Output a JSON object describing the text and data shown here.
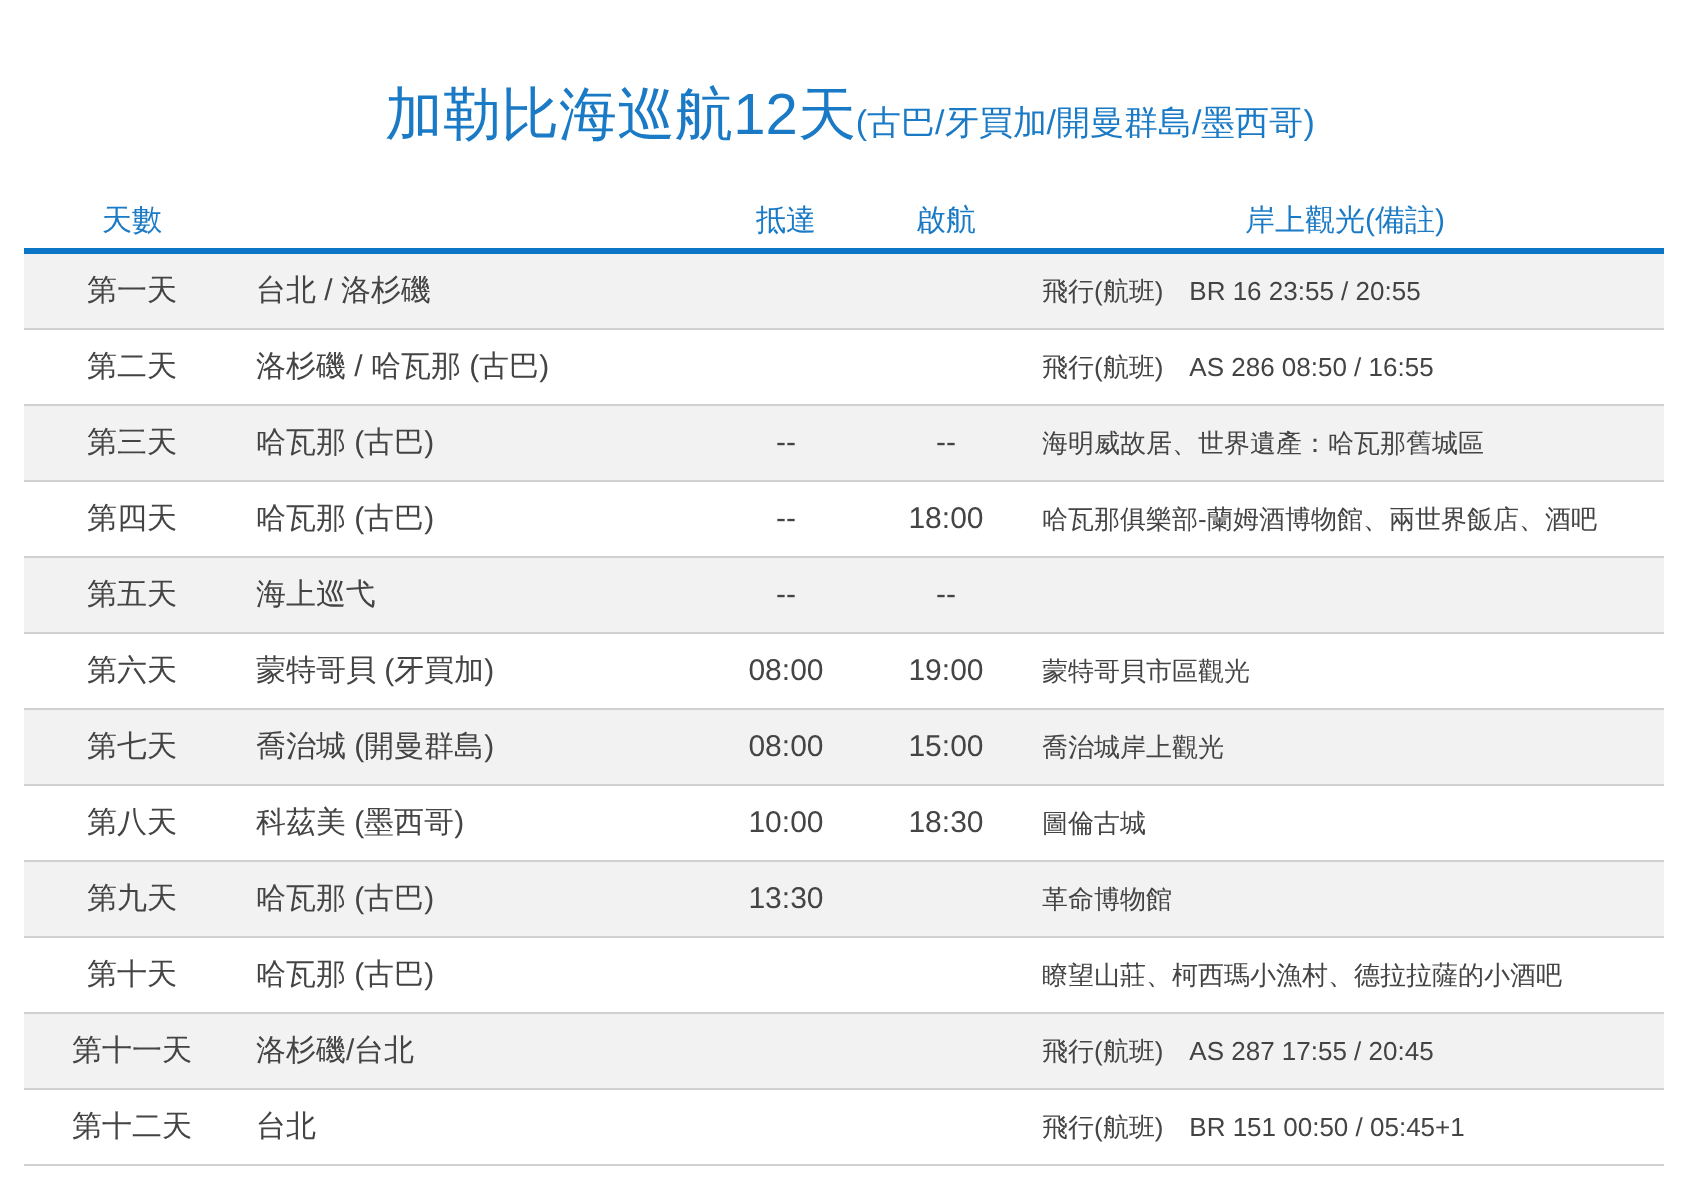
{
  "title": "加勒比海巡航12天",
  "subtitle": "(古巴/牙買加/開曼群島/墨西哥)",
  "header": {
    "day": "天數",
    "arrive": "抵達",
    "depart": "啟航",
    "notes": "岸上觀光(備註)"
  },
  "rows": [
    {
      "day": "第一天",
      "port": "台北 / 洛杉磯",
      "note": "飛行(航班)　BR 16 23:55 / 20:55"
    },
    {
      "day": "第二天",
      "port": "洛杉磯 / 哈瓦那 (古巴)",
      "note": "飛行(航班)　AS 286 08:50 / 16:55"
    },
    {
      "day": "第三天",
      "port": "哈瓦那 (古巴)",
      "arrive": "--",
      "depart": "--",
      "note": "海明威故居、世界遺產：哈瓦那舊城區"
    },
    {
      "day": "第四天",
      "port": "哈瓦那 (古巴)",
      "arrive": "--",
      "depart": "18:00",
      "note": "哈瓦那俱樂部-蘭姆酒博物館、兩世界飯店、酒吧"
    },
    {
      "day": "第五天",
      "port": "海上巡弋",
      "arrive": "--",
      "depart": "--"
    },
    {
      "day": "第六天",
      "port": "蒙特哥貝 (牙買加)",
      "arrive": "08:00",
      "depart": "19:00",
      "note": "蒙特哥貝市區觀光"
    },
    {
      "day": "第七天",
      "port": "喬治城 (開曼群島)",
      "arrive": "08:00",
      "depart": "15:00",
      "note": "喬治城岸上觀光"
    },
    {
      "day": "第八天",
      "port": "科茲美 (墨西哥)",
      "arrive": "10:00",
      "depart": "18:30",
      "note": "圖倫古城"
    },
    {
      "day": "第九天",
      "port": "哈瓦那 (古巴)",
      "arrive": "13:30",
      "note": "革命博物館"
    },
    {
      "day": "第十天",
      "port": "哈瓦那 (古巴)",
      "note": "瞭望山莊、柯西瑪小漁村、德拉拉薩的小酒吧"
    },
    {
      "day": "第十一天",
      "port": "洛杉磯/台北",
      "note": "飛行(航班)　AS 287 17:55 / 20:45"
    },
    {
      "day": "第十二天",
      "port": "台北",
      "note": "飛行(航班)　BR 151 00:50 / 05:45+1"
    }
  ]
}
